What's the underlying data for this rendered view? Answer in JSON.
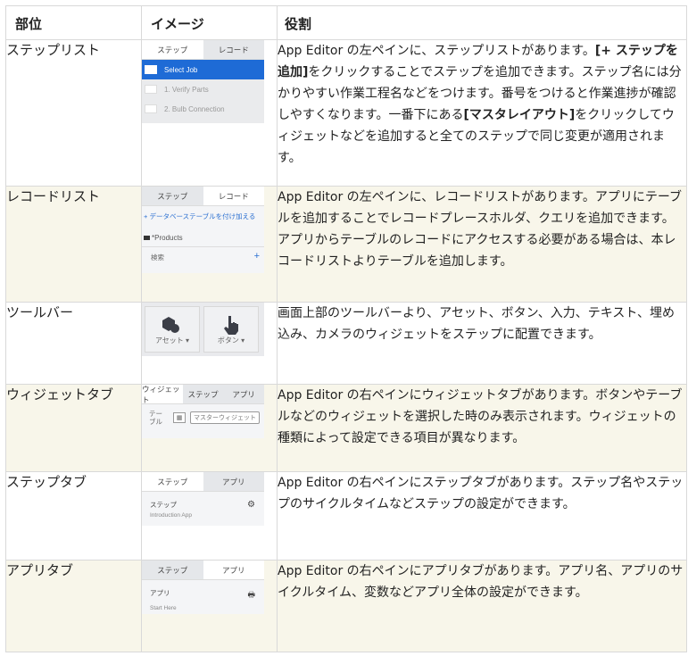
{
  "headers": {
    "part": "部位",
    "image": "イメージ",
    "role": "役割"
  },
  "rows": [
    {
      "part": "ステップリスト",
      "mini": {
        "tab1": "ステップ",
        "tab2": "レコード",
        "items": [
          "Select Job",
          "1. Verify Parts",
          "2. Bulb Connection"
        ]
      },
      "desc": [
        "App Editor の左ペインに、ステップリストがあります。",
        "[+ ステップを追加]",
        "をクリックすることでステップを追加できます。ステップ名には分かりやすい作業工程名などをつけます。番号をつけると作業進捗が確認しやすくなります。一番下にある",
        "[マスタレイアウト]",
        "をクリックしてウィジェットなどを追加すると全てのステップで同じ変更が適用されます。"
      ]
    },
    {
      "part": "レコードリスト",
      "mini": {
        "tab1": "ステップ",
        "tab2": "レコード",
        "add": "+ データベーステーブルを付け加える",
        "table": "*Products",
        "search": "検索"
      },
      "desc": "App Editor の左ペインに、レコードリストがあります。アプリにテーブルを追加することでレコードプレースホルダ、クエリを追加できます。アプリからテーブルのレコードにアクセスする必要がある場合は、本レコードリストよりテーブルを追加します。"
    },
    {
      "part": "ツールバー",
      "mini": {
        "asset": "アセット ▾",
        "button": "ボタン ▾"
      },
      "desc": "画面上部のツールバーより、アセット、ボタン、入力、テキスト、埋め込み、カメラのウィジェットをステップに配置できます。"
    },
    {
      "part": "ウィジェットタブ",
      "mini": {
        "tab1": "ウィジェット",
        "tab2": "ステップ",
        "tab3": "アプリ",
        "label": "テーブル",
        "master": "マスターウィジェット"
      },
      "desc": "App Editor の右ペインにウィジェットタブがあります。ボタンやテーブルなどのウィジェットを選択した時のみ表示されます。ウィジェットの種類によって設定できる項目が異なります。"
    },
    {
      "part": "ステップタブ",
      "mini": {
        "tab1": "ステップ",
        "tab2": "アプリ",
        "name": "ステップ",
        "sub": "Introduction App"
      },
      "desc": "App Editor の右ペインにステップタブがあります。ステップ名やステップのサイクルタイムなどステップの設定ができます。"
    },
    {
      "part": "アプリタブ",
      "mini": {
        "tab1": "ステップ",
        "tab2": "アプリ",
        "name": "アプリ",
        "sub": "Start Here"
      },
      "desc": "App Editor の右ペインにアプリタブがあります。アプリ名、アプリのサイクルタイム、変数などアプリ全体の設定ができます。"
    }
  ]
}
